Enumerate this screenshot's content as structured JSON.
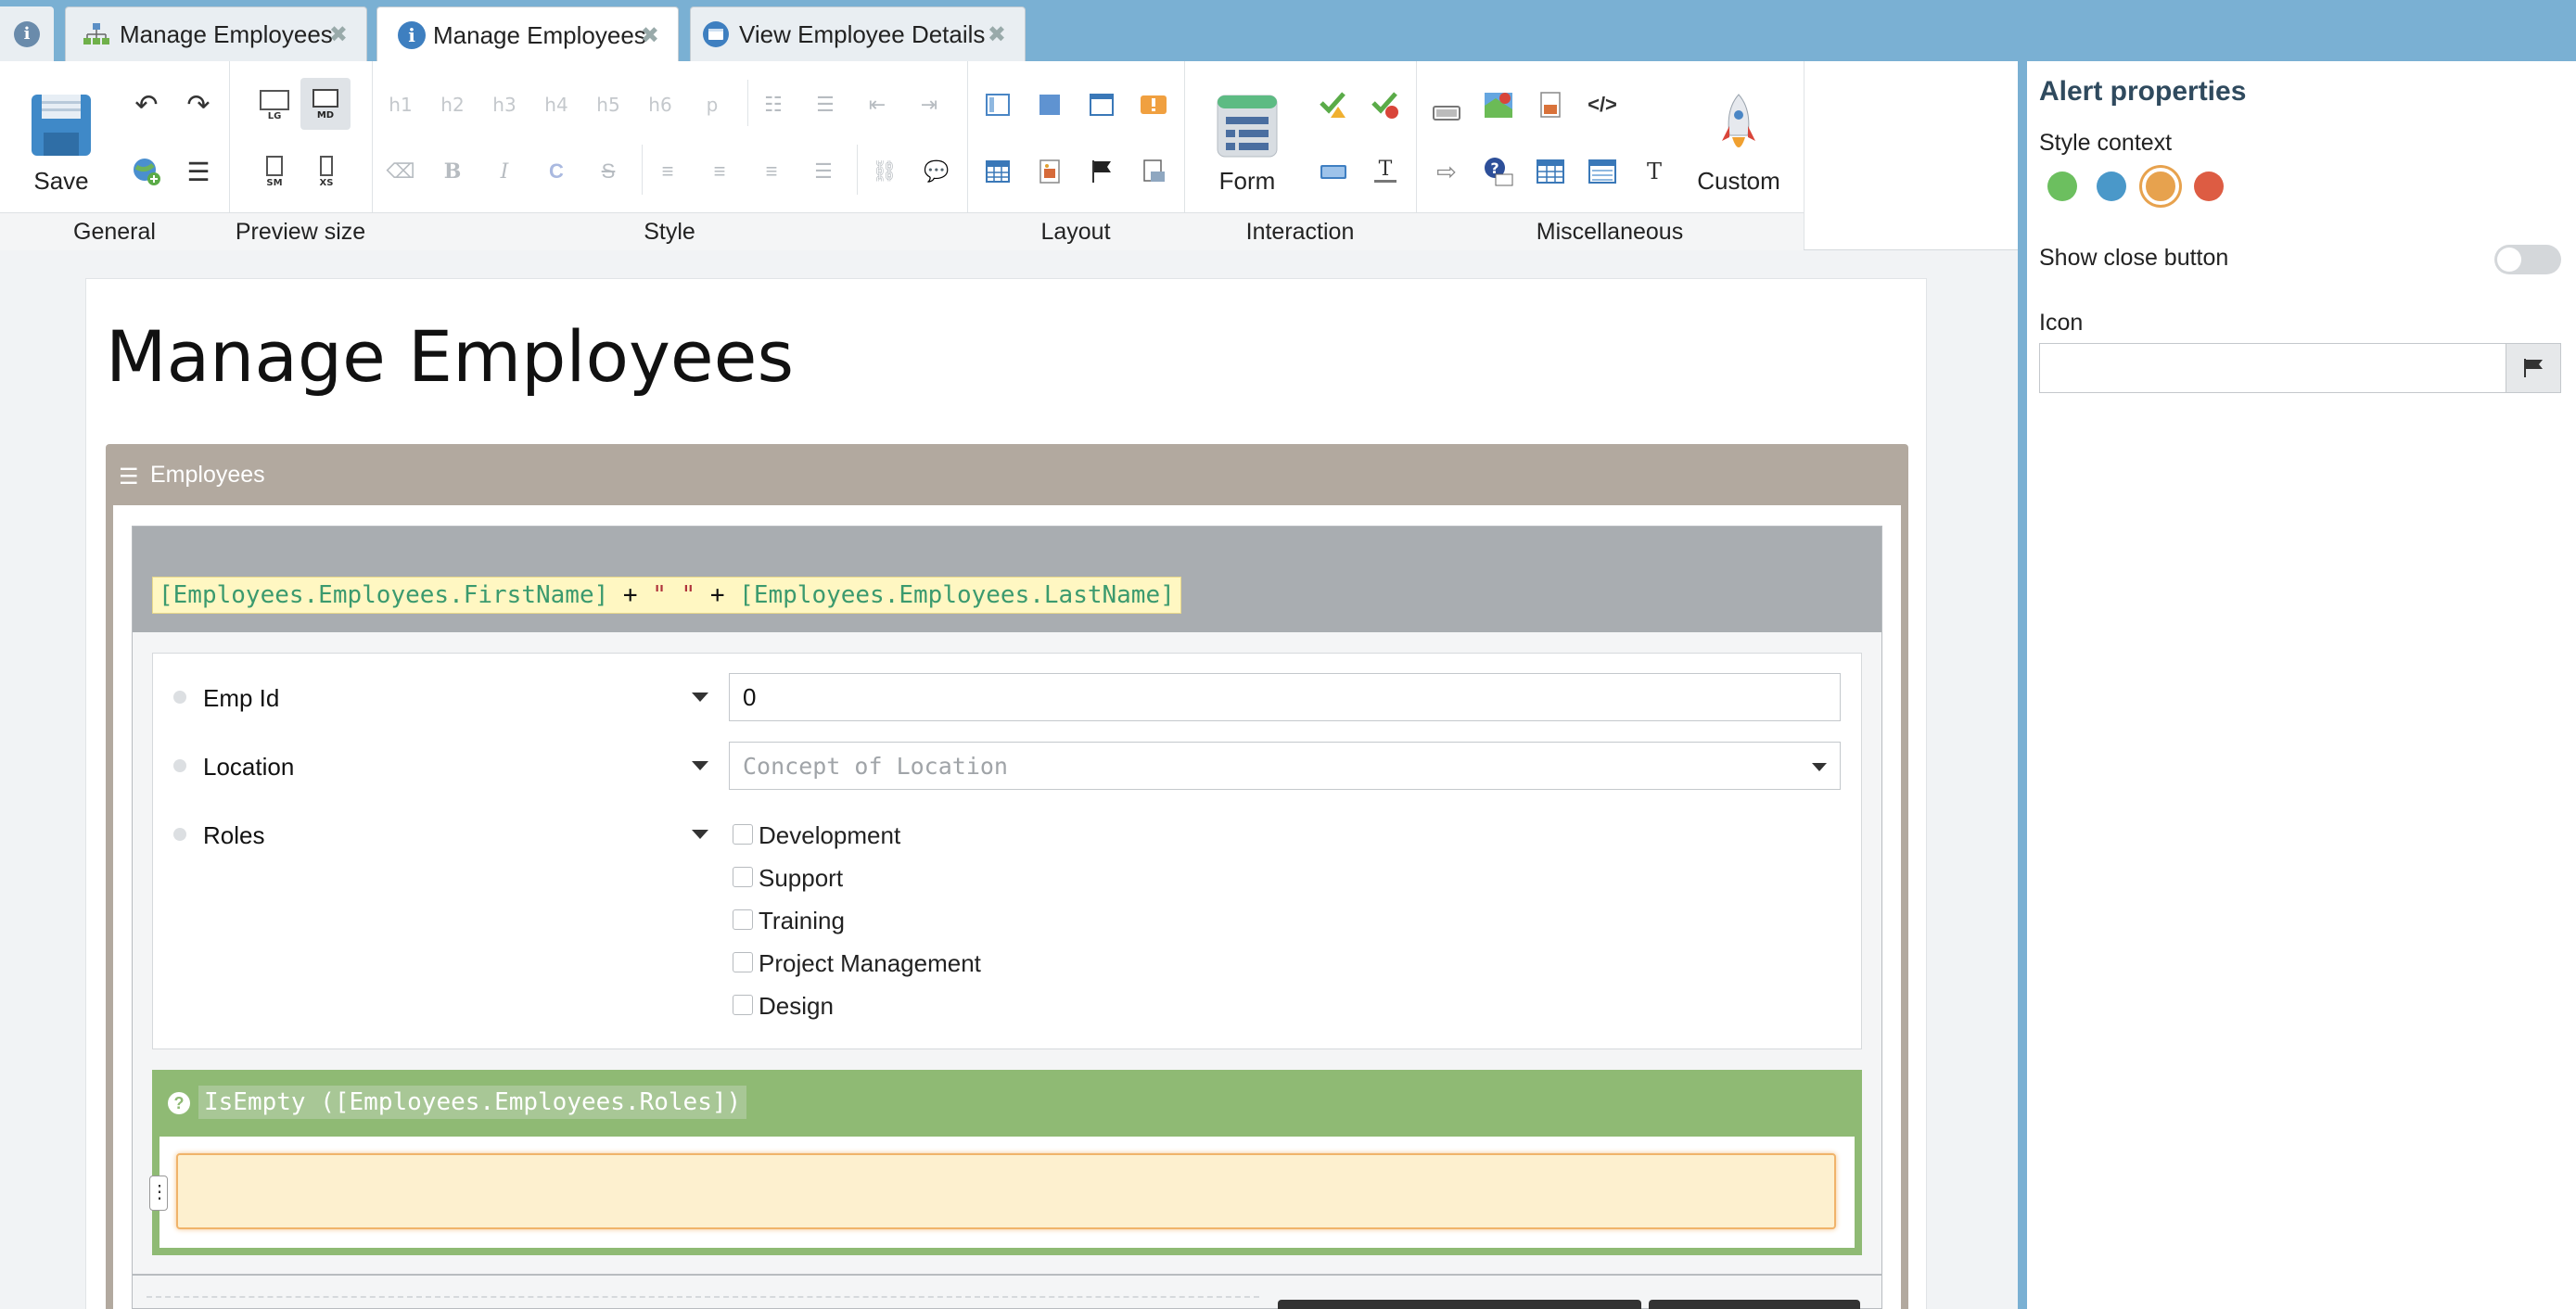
{
  "tabs": [
    {
      "label": "Manage Employees",
      "icon": "sitemap-icon",
      "active": false
    },
    {
      "label": "Manage Employees",
      "icon": "info-icon",
      "active": true
    },
    {
      "label": "View Employee Details",
      "icon": "window-icon",
      "active": false
    }
  ],
  "tab_close_glyph": "✖",
  "ribbon": {
    "save_label": "Save",
    "form_label": "Form",
    "custom_label": "Custom",
    "heading_buttons": [
      "h1",
      "h2",
      "h3",
      "h4",
      "h5",
      "h6",
      "p"
    ],
    "groups": [
      "General",
      "Preview size",
      "Style",
      "Layout",
      "Interaction",
      "Miscellaneous"
    ],
    "preview_sizes": [
      "LG",
      "MD",
      "SM",
      "XS"
    ]
  },
  "properties": {
    "title": "Alert properties",
    "style_context_label": "Style context",
    "style_colors": [
      "#6cbf5f",
      "#4a98c9",
      "#e7a24e",
      "#dd5c43"
    ],
    "selected_color_index": 2,
    "show_close_label": "Show close button",
    "show_close_value": false,
    "icon_label": "Icon",
    "icon_value": ""
  },
  "page": {
    "title": "Manage Employees",
    "panel_title": "Employees",
    "repeater_expression": {
      "part1": "[Employees.Employees.FirstName]",
      "op1": "+",
      "str": "\" \"",
      "op2": "+",
      "part2": "[Employees.Employees.LastName]"
    },
    "fields": [
      {
        "label": "Emp Id",
        "value": "0"
      },
      {
        "label": "Location",
        "placeholder": "Concept of Location"
      },
      {
        "label": "Roles"
      }
    ],
    "roles_options": [
      "Development",
      "Support",
      "Training",
      "Project Management",
      "Design"
    ],
    "condition_expression": "IsEmpty ([Employees.Employees.Roles])"
  }
}
